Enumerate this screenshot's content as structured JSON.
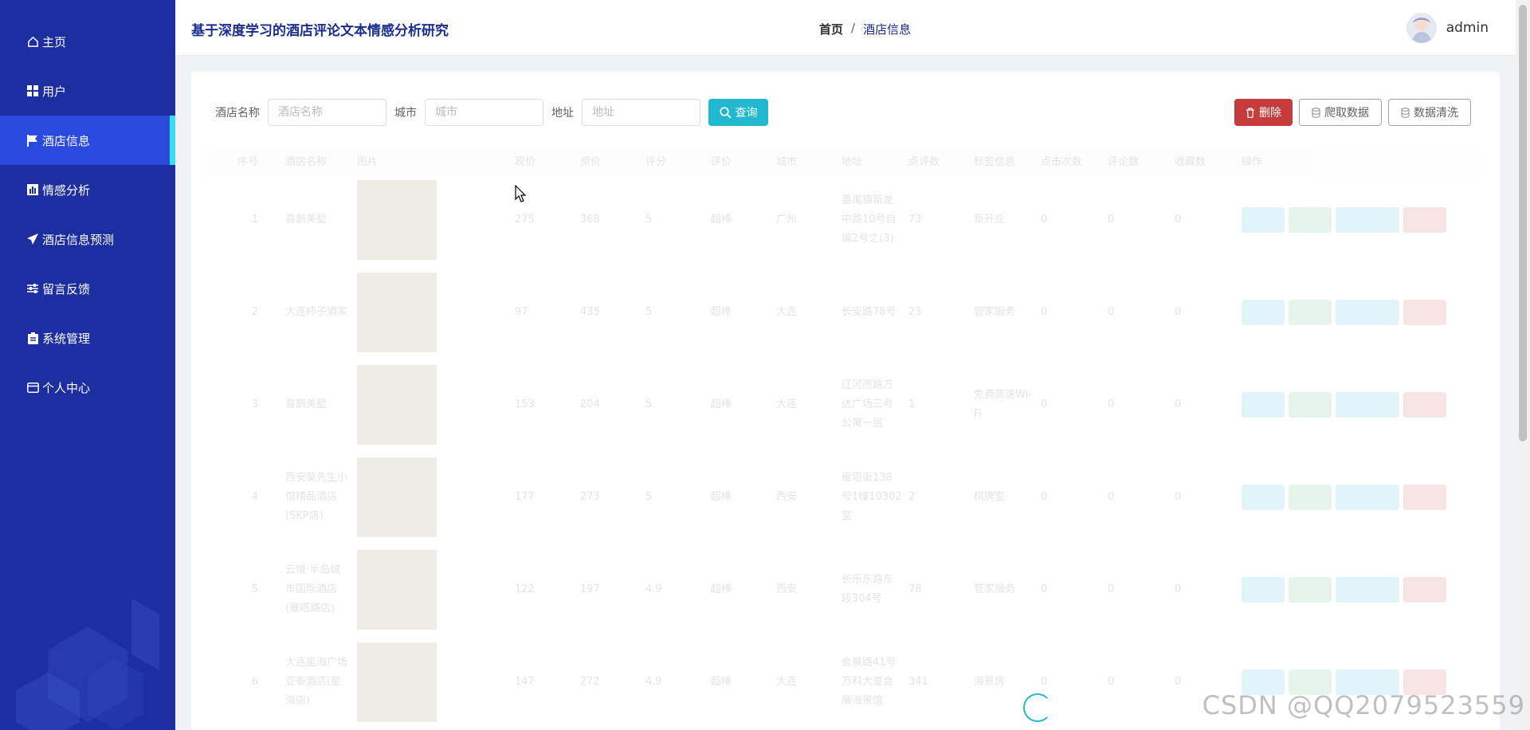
{
  "app": {
    "title": "基于深度学习的酒店评论文本情感分析研究"
  },
  "sidebar": {
    "items": [
      {
        "label": "主页",
        "icon": "home-icon",
        "active": false
      },
      {
        "label": "用户",
        "icon": "grid-icon",
        "active": false
      },
      {
        "label": "酒店信息",
        "icon": "flag-icon",
        "active": true
      },
      {
        "label": "情感分析",
        "icon": "chart-icon",
        "active": false
      },
      {
        "label": "酒店信息预测",
        "icon": "send-icon",
        "active": false
      },
      {
        "label": "留言反馈",
        "icon": "sliders-icon",
        "active": false
      },
      {
        "label": "系统管理",
        "icon": "clipboard-icon",
        "active": false
      },
      {
        "label": "个人中心",
        "icon": "card-icon",
        "active": false
      }
    ]
  },
  "breadcrumb": {
    "home": "首页",
    "separator": "/",
    "current": "酒店信息"
  },
  "user": {
    "name": "admin"
  },
  "search": {
    "fields": [
      {
        "label": "酒店名称",
        "placeholder": "酒店名称"
      },
      {
        "label": "城市",
        "placeholder": "城市"
      },
      {
        "label": "地址",
        "placeholder": "地址"
      }
    ],
    "query_label": "查询"
  },
  "toolbar": {
    "delete_label": "删除",
    "crawl_label": "爬取数据",
    "clean_label": "数据清洗"
  },
  "table": {
    "columns": [
      "序号",
      "酒店名称",
      "图片",
      "现价",
      "原价",
      "评分",
      "评价",
      "城市",
      "地址",
      "点评数",
      "标签信息",
      "点击次数",
      "评论数",
      "收藏数",
      "操作"
    ],
    "rows": [
      {
        "idx": "1",
        "name": "喜鹊美墅",
        "price": "275",
        "orig": "368",
        "score": "5",
        "eval": "超棒",
        "city": "广州",
        "addr": "番禺镇新龙中路10号自编2号之(3)",
        "reviews": "73",
        "tag": "新开业",
        "clicks": "0",
        "comments": "0",
        "favs": "0"
      },
      {
        "idx": "2",
        "name": "大连柿子酒家",
        "price": "97",
        "orig": "435",
        "score": "5",
        "eval": "超棒",
        "city": "大连",
        "addr": "长安路78号",
        "reviews": "23",
        "tag": "管家服务",
        "clicks": "0",
        "comments": "0",
        "favs": "0"
      },
      {
        "idx": "3",
        "name": "喜鹊美墅",
        "price": "153",
        "orig": "204",
        "score": "5",
        "eval": "超棒",
        "city": "大连",
        "addr": "辽河西路万达广场三号公寓一层",
        "reviews": "1",
        "tag": "免费高速Wi-Fi",
        "clicks": "0",
        "comments": "0",
        "favs": "0"
      },
      {
        "idx": "4",
        "name": "西安莫先生小馆精品酒店(SKP店)",
        "price": "177",
        "orig": "273",
        "score": "5",
        "eval": "超棒",
        "city": "西安",
        "addr": "雁塔街138号1幢10302室",
        "reviews": "2",
        "tag": "棋牌室",
        "clicks": "0",
        "comments": "0",
        "favs": "0"
      },
      {
        "idx": "5",
        "name": "云境·半岛城市国际酒店(雁塔路店)",
        "price": "122",
        "orig": "197",
        "score": "4.9",
        "eval": "超棒",
        "city": "西安",
        "addr": "长乐东路东段304号",
        "reviews": "78",
        "tag": "管家服务",
        "clicks": "0",
        "comments": "0",
        "favs": "0"
      },
      {
        "idx": "6",
        "name": "大连星海广场亚泰酒店(星海店)",
        "price": "147",
        "orig": "272",
        "score": "4.9",
        "eval": "超棒",
        "city": "大连",
        "addr": "会展路41号万科大厦会展海景馆",
        "reviews": "341",
        "tag": "海景房",
        "clicks": "0",
        "comments": "0",
        "favs": "0"
      }
    ]
  },
  "watermark": "CSDN @QQ2079523559",
  "colors": {
    "sidebar": "#1c2ea0",
    "active_item": "#2a4ae0",
    "active_bar": "#36e0ef",
    "primary": "#22b8cf",
    "danger": "#c63c3c"
  }
}
